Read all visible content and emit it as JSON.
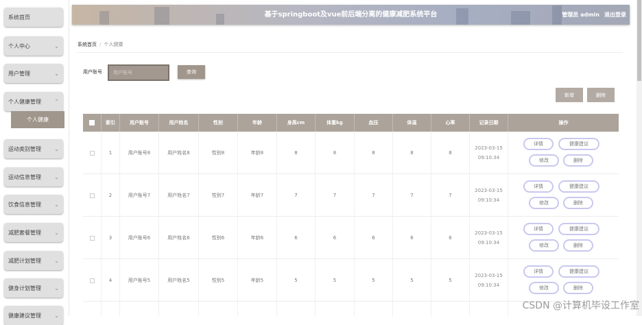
{
  "app": {
    "title": "基于springboot及vue前后端分离的健康减肥系统平台",
    "user_label": "管理员 admin",
    "logout_label": "退出登录"
  },
  "sidebar": {
    "items": [
      {
        "label": "系统首页"
      },
      {
        "label": "个人中心"
      },
      {
        "label": "用户管理"
      },
      {
        "label": "个人健康管理"
      },
      {
        "label": "运动类别管理"
      },
      {
        "label": "运动信息管理"
      },
      {
        "label": "饮食信息管理"
      },
      {
        "label": "减肥套餐管理"
      },
      {
        "label": "减肥计划管理"
      },
      {
        "label": "健身计划管理"
      },
      {
        "label": "健康建议管理"
      }
    ],
    "sub_item": "个人健康"
  },
  "breadcrumb": {
    "home": "系统首页",
    "sep": "/",
    "current": "个人健康"
  },
  "search": {
    "label": "用户账号",
    "placeholder": "用户账号",
    "button": "查询"
  },
  "actions": {
    "add": "新增",
    "delete": "删除"
  },
  "table": {
    "headers": [
      "索引",
      "用户账号",
      "用户姓名",
      "性别",
      "年龄",
      "身高cm",
      "体重kg",
      "血压",
      "体温",
      "心率",
      "记录日期",
      "操作"
    ],
    "rows": [
      {
        "index": "1",
        "account": "用户账号8",
        "name": "用户姓名8",
        "gender": "性别8",
        "age": "年龄8",
        "height": "8",
        "weight": "8",
        "bp": "8",
        "temp": "8",
        "hr": "8",
        "date": "2023-03-15",
        "time": "09:10:34"
      },
      {
        "index": "2",
        "account": "用户账号7",
        "name": "用户姓名7",
        "gender": "性别7",
        "age": "年龄7",
        "height": "7",
        "weight": "7",
        "bp": "7",
        "temp": "7",
        "hr": "7",
        "date": "2023-03-15",
        "time": "09:10:34"
      },
      {
        "index": "3",
        "account": "用户账号6",
        "name": "用户姓名6",
        "gender": "性别6",
        "age": "年龄6",
        "height": "6",
        "weight": "6",
        "bp": "6",
        "temp": "6",
        "hr": "6",
        "date": "2023-03-15",
        "time": "09:10:34"
      },
      {
        "index": "4",
        "account": "用户账号5",
        "name": "用户姓名5",
        "gender": "性别5",
        "age": "年龄5",
        "height": "5",
        "weight": "5",
        "bp": "5",
        "temp": "5",
        "hr": "5",
        "date": "2023-03-15",
        "time": "09:10:34"
      }
    ],
    "row_ops": {
      "detail": "详情",
      "advice": "健康建议",
      "edit": "修改",
      "delete": "删除"
    }
  },
  "watermark": "CSDN @计算机毕设工作室",
  "colors": {
    "accent": "#a0968c",
    "header_bg": "#aca39b",
    "op_border": "#c8c8ee"
  },
  "icons": {
    "sidebar_chevron": "chevron-down-icon",
    "expanded_chevron": "chevron-up-icon"
  }
}
